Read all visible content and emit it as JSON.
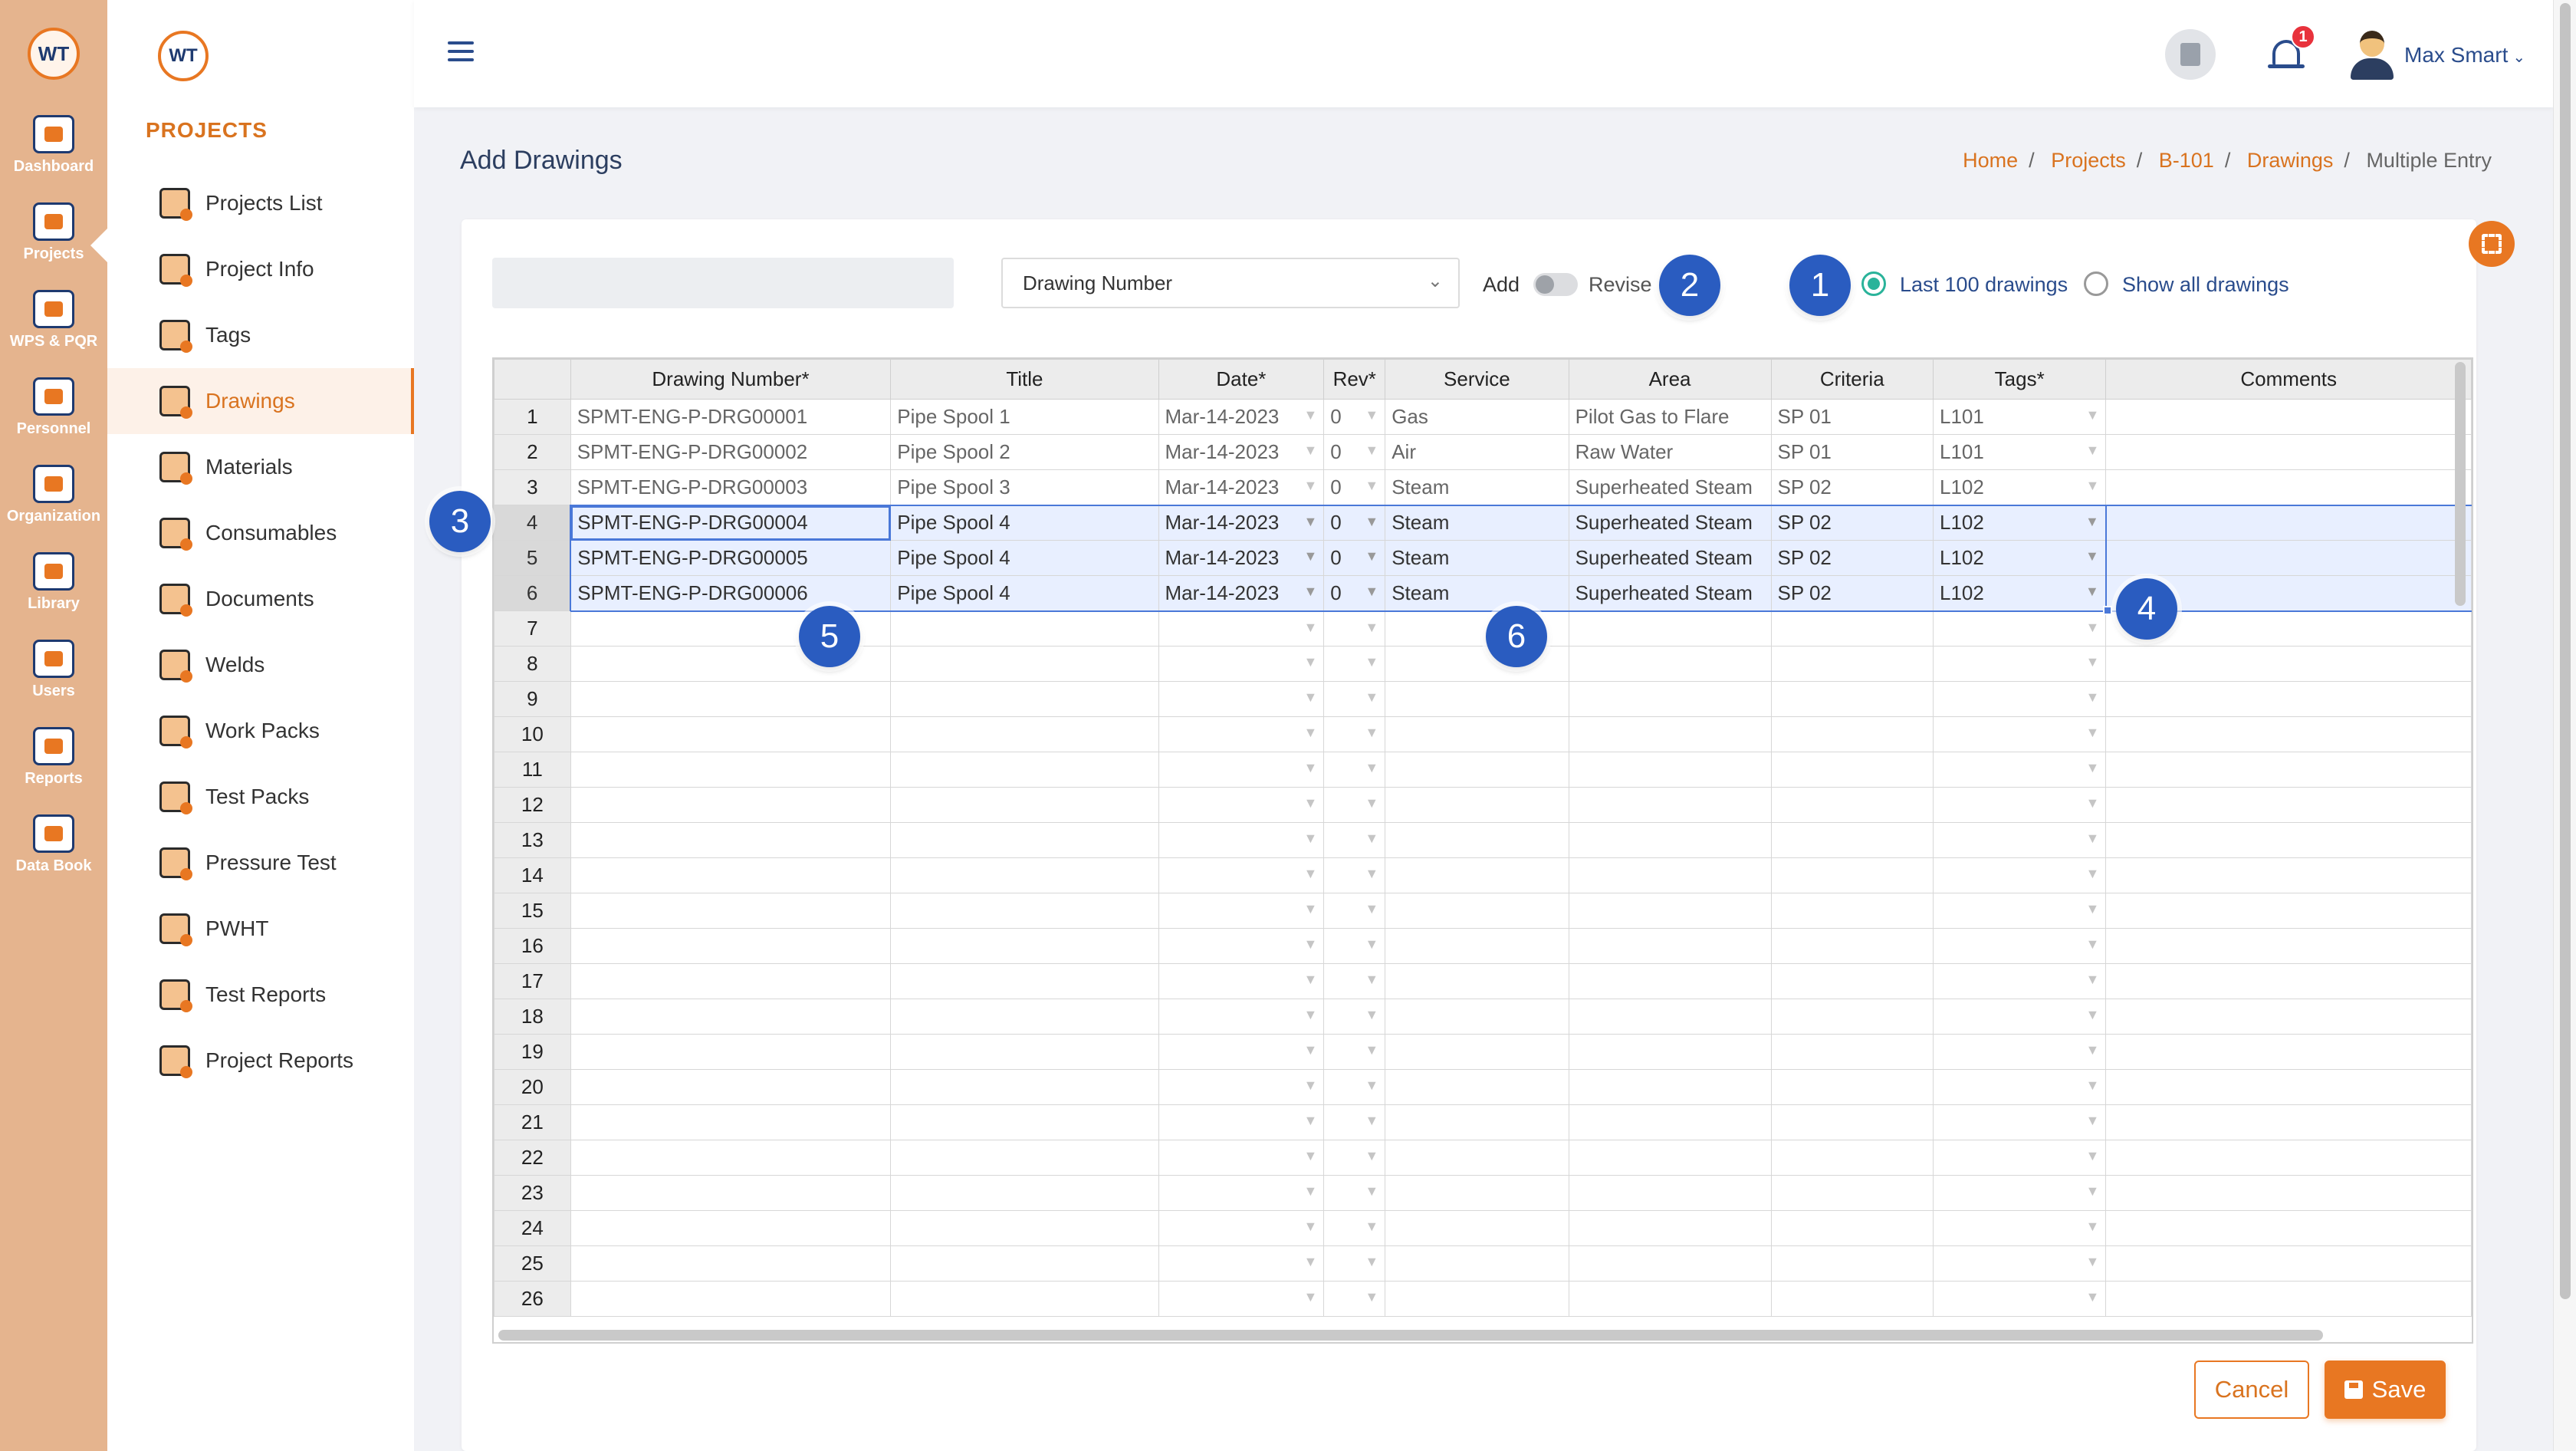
{
  "rail": {
    "logo": "WT",
    "items": [
      {
        "label": "Dashboard",
        "icon": "monitor-chart-icon"
      },
      {
        "label": "Projects",
        "icon": "folder-gear-icon"
      },
      {
        "label": "WPS & PQR",
        "icon": "clipboard-gear-icon"
      },
      {
        "label": "Personnel",
        "icon": "welder-mask-icon"
      },
      {
        "label": "Organization",
        "icon": "org-chart-icon"
      },
      {
        "label": "Library",
        "icon": "book-shelf-icon"
      },
      {
        "label": "Users",
        "icon": "users-group-icon"
      },
      {
        "label": "Reports",
        "icon": "report-clock-icon"
      },
      {
        "label": "Data Book",
        "icon": "data-book-icon"
      }
    ]
  },
  "sidebar": {
    "logo": "WT",
    "heading": "PROJECTS",
    "items": [
      {
        "label": "Projects List",
        "icon": "folder-list-icon"
      },
      {
        "label": "Project Info",
        "icon": "gears-info-icon"
      },
      {
        "label": "Tags",
        "icon": "tag-icon"
      },
      {
        "label": "Drawings",
        "icon": "drawing-compass-icon",
        "active": true
      },
      {
        "label": "Materials",
        "icon": "pipes-stack-icon"
      },
      {
        "label": "Consumables",
        "icon": "spool-icon"
      },
      {
        "label": "Documents",
        "icon": "folder-docs-icon"
      },
      {
        "label": "Welds",
        "icon": "weld-spark-icon"
      },
      {
        "label": "Work Packs",
        "icon": "work-pack-icon"
      },
      {
        "label": "Test Packs",
        "icon": "radiation-icon"
      },
      {
        "label": "Pressure Test",
        "icon": "pressure-gauge-icon"
      },
      {
        "label": "PWHT",
        "icon": "heat-coil-icon"
      },
      {
        "label": "Test Reports",
        "icon": "test-report-icon"
      },
      {
        "label": "Project Reports",
        "icon": "project-report-icon"
      }
    ]
  },
  "header": {
    "user_name": "Max Smart",
    "notification_count": "1"
  },
  "page": {
    "title": "Add Drawings",
    "breadcrumb": {
      "home": "Home",
      "projects": "Projects",
      "project": "B-101",
      "drawings": "Drawings",
      "current": "Multiple Entry"
    }
  },
  "toolbar": {
    "search_value": "",
    "select_value": "Drawing Number",
    "add_label": "Add",
    "revise_label": "Revise",
    "radio_last": "Last 100 drawings",
    "radio_all": "Show all drawings"
  },
  "callouts": [
    "1",
    "2",
    "3",
    "4",
    "5",
    "6"
  ],
  "grid": {
    "columns": [
      "Drawing Number*",
      "Title",
      "Date*",
      "Rev*",
      "Service",
      "Area",
      "Criteria",
      "Tags*",
      "Comments"
    ],
    "rows": [
      [
        "SPMT-ENG-P-DRG00001",
        "Pipe Spool 1",
        "Mar-14-2023",
        "0",
        "Gas",
        "Pilot Gas to Flare",
        "SP 01",
        "L101",
        ""
      ],
      [
        "SPMT-ENG-P-DRG00002",
        "Pipe Spool 2",
        "Mar-14-2023",
        "0",
        "Air",
        "Raw Water",
        "SP 01",
        "L101",
        ""
      ],
      [
        "SPMT-ENG-P-DRG00003",
        "Pipe Spool 3",
        "Mar-14-2023",
        "0",
        "Steam",
        "Superheated Steam",
        "SP 02",
        "L102",
        ""
      ],
      [
        "SPMT-ENG-P-DRG00004",
        "Pipe Spool 4",
        "Mar-14-2023",
        "0",
        "Steam",
        "Superheated Steam",
        "SP 02",
        "L102",
        ""
      ],
      [
        "SPMT-ENG-P-DRG00005",
        "Pipe Spool 4",
        "Mar-14-2023",
        "0",
        "Steam",
        "Superheated Steam",
        "SP 02",
        "L102",
        ""
      ],
      [
        "SPMT-ENG-P-DRG00006",
        "Pipe Spool 4",
        "Mar-14-2023",
        "0",
        "Steam",
        "Superheated Steam",
        "SP 02",
        "L102",
        ""
      ]
    ],
    "total_rows": 26,
    "selected_rows": [
      4,
      5,
      6
    ]
  },
  "actions": {
    "cancel": "Cancel",
    "save": "Save"
  },
  "colors": {
    "accent": "#e87722",
    "rail_bg": "#e5b48e",
    "callout": "#2a5cc0",
    "radio_checked": "#2ab39a",
    "selection": "#4a78d8"
  }
}
